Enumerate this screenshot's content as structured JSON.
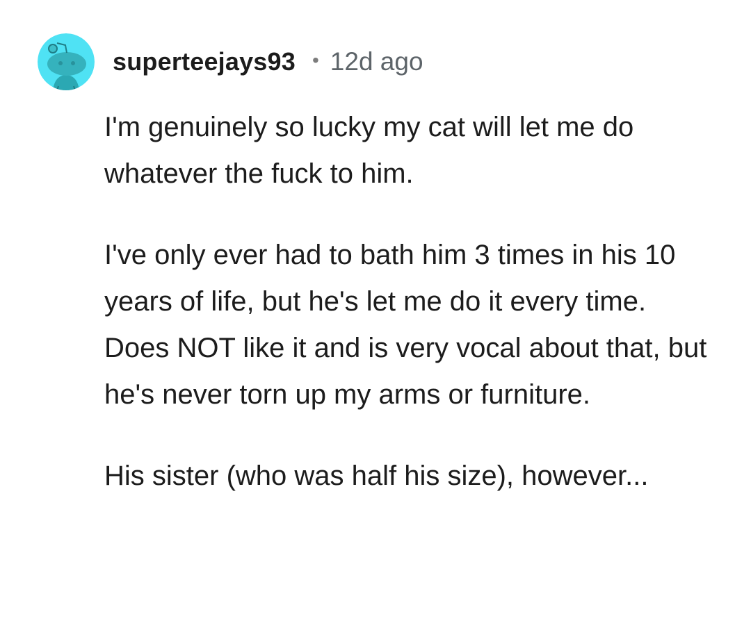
{
  "comment": {
    "avatar_icon": "snoo-avatar-icon",
    "avatar_bg": "#4fd6f0",
    "username": "superteejays93",
    "separator": "•",
    "timestamp": "12d ago",
    "paragraphs": [
      "I'm genuinely so lucky my cat will let me do whatever the fuck to him.",
      "I've only ever had to bath him 3 times in his 10 years of life, but he's let me do it every time. Does NOT like it and is very vocal about that, but he's never torn up my arms or furniture.",
      "His sister (who was half his size), however..."
    ]
  }
}
